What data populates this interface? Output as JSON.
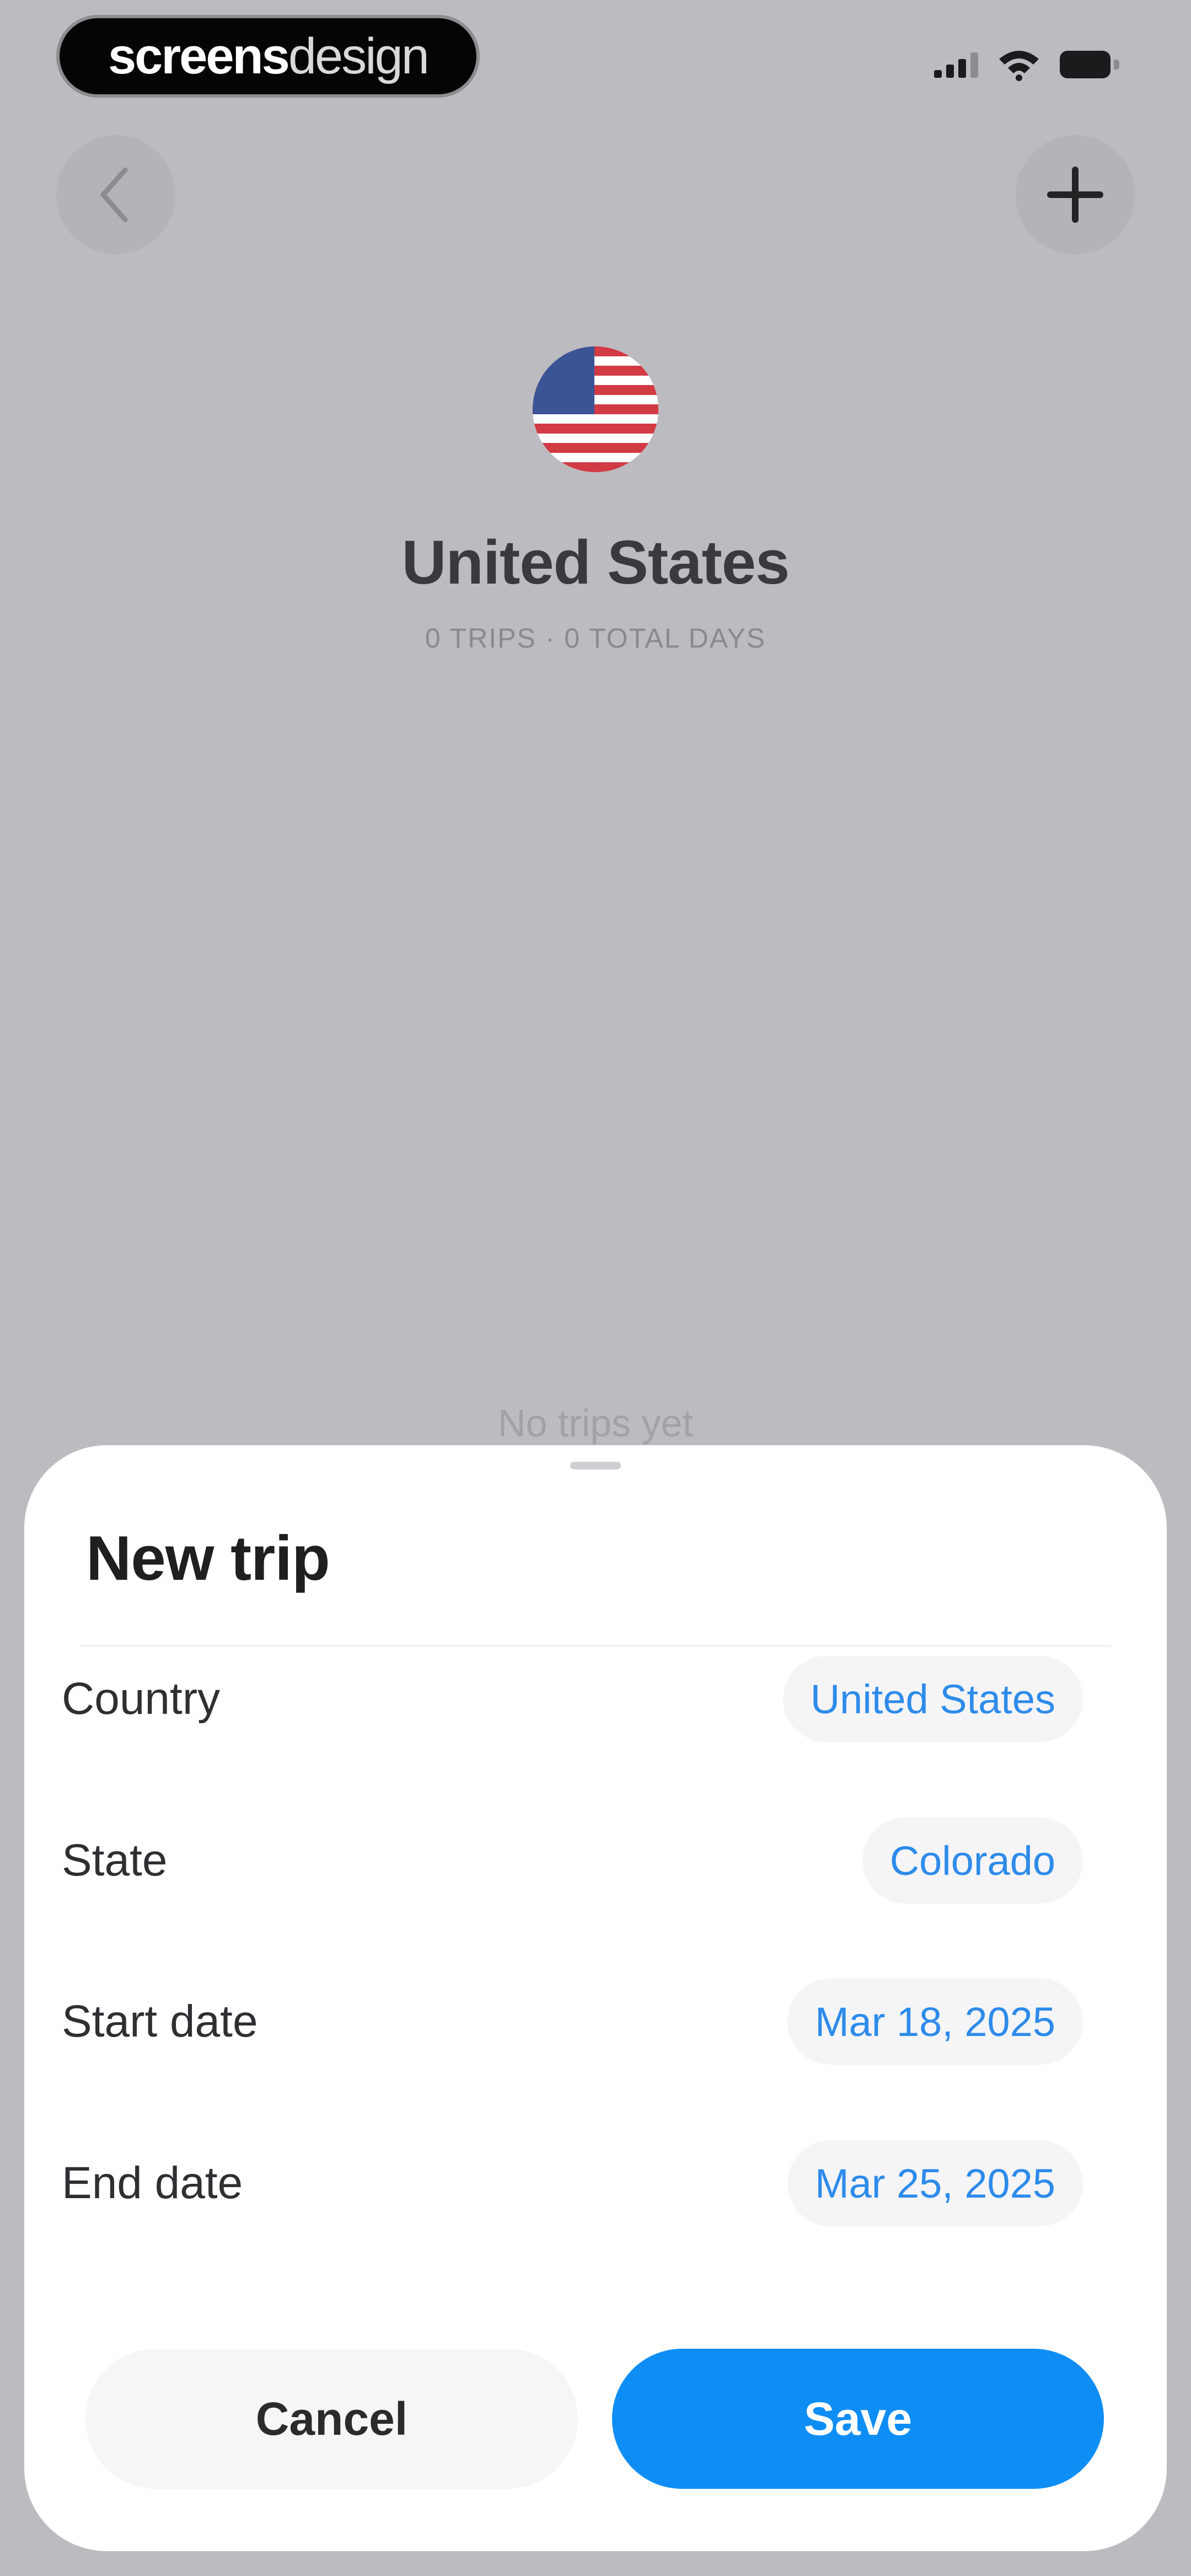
{
  "status_bar": {
    "brand_strong": "screens",
    "brand_light": "design"
  },
  "header": {
    "back_icon": "chevron-left-icon",
    "add_icon": "plus-icon",
    "flag_icon": "us-flag-icon",
    "country_name": "United States",
    "stats": "0 TRIPS · 0 TOTAL DAYS"
  },
  "main": {
    "empty_message": "No trips yet"
  },
  "sheet": {
    "title": "New trip",
    "fields": [
      {
        "label": "Country",
        "value": "United States"
      },
      {
        "label": "State",
        "value": "Colorado"
      },
      {
        "label": "Start date",
        "value": "Mar 18, 2025"
      },
      {
        "label": "End date",
        "value": "Mar 25, 2025"
      }
    ],
    "cancel_label": "Cancel",
    "save_label": "Save"
  },
  "colors": {
    "accent": "#0e8ef5",
    "link": "#2d8bea",
    "backdrop": "#bcbbc0"
  }
}
